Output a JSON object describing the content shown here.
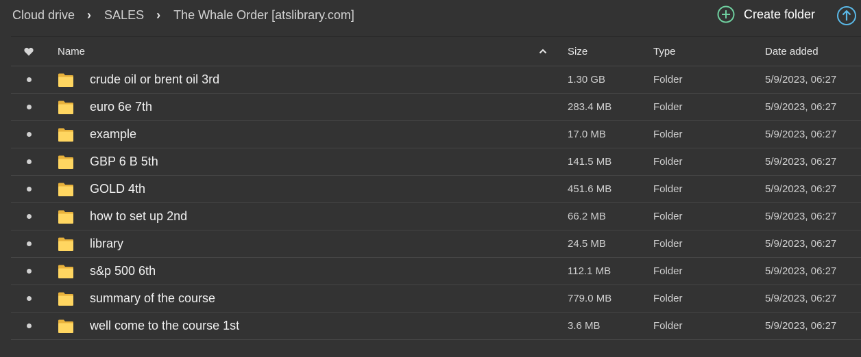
{
  "breadcrumb": {
    "items": [
      "Cloud drive",
      "SALES",
      "The Whale Order [atslibrary.com]"
    ]
  },
  "toolbar": {
    "create_folder_label": "Create folder",
    "create_folder_icon": "plus-circle-icon",
    "upload_icon": "arrow-up-circle-icon",
    "accent_green": "#6fcf9f",
    "accent_blue": "#5ab9e8"
  },
  "table": {
    "columns": {
      "favorite": "heart-icon",
      "name": "Name",
      "sort": "up",
      "size": "Size",
      "type": "Type",
      "date": "Date added"
    },
    "rows": [
      {
        "name": "crude oil or brent oil 3rd",
        "size": "1.30 GB",
        "type": "Folder",
        "date": "5/9/2023, 06:27"
      },
      {
        "name": "euro 6e 7th",
        "size": "283.4 MB",
        "type": "Folder",
        "date": "5/9/2023, 06:27"
      },
      {
        "name": "example",
        "size": "17.0 MB",
        "type": "Folder",
        "date": "5/9/2023, 06:27"
      },
      {
        "name": "GBP 6 B 5th",
        "size": "141.5 MB",
        "type": "Folder",
        "date": "5/9/2023, 06:27"
      },
      {
        "name": "GOLD 4th",
        "size": "451.6 MB",
        "type": "Folder",
        "date": "5/9/2023, 06:27"
      },
      {
        "name": "how to set up 2nd",
        "size": "66.2 MB",
        "type": "Folder",
        "date": "5/9/2023, 06:27"
      },
      {
        "name": "library",
        "size": "24.5 MB",
        "type": "Folder",
        "date": "5/9/2023, 06:27"
      },
      {
        "name": "s&p 500 6th",
        "size": "112.1 MB",
        "type": "Folder",
        "date": "5/9/2023, 06:27"
      },
      {
        "name": "summary of the course",
        "size": "779.0 MB",
        "type": "Folder",
        "date": "5/9/2023, 06:27"
      },
      {
        "name": "well come to the course 1st",
        "size": "3.6 MB",
        "type": "Folder",
        "date": "5/9/2023, 06:27"
      }
    ]
  }
}
